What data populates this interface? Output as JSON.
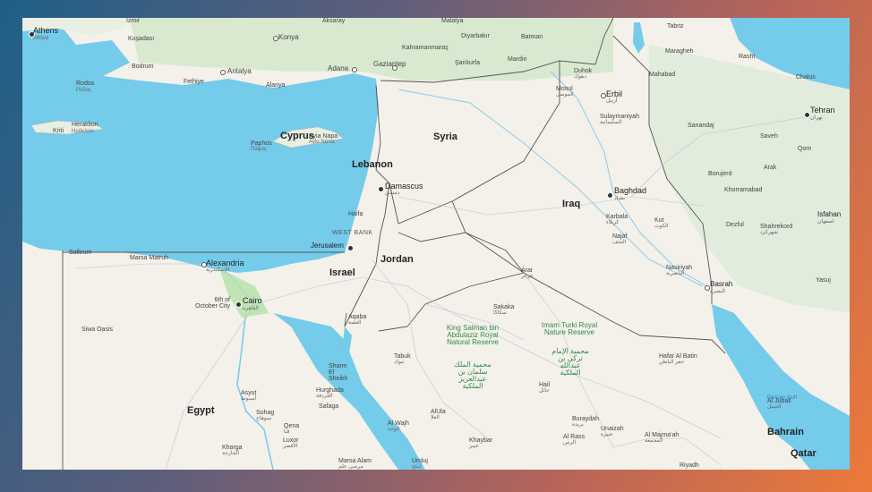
{
  "countries": [
    {
      "id": "syria",
      "label": "Syria"
    },
    {
      "id": "iraq",
      "label": "Iraq"
    },
    {
      "id": "lebanon",
      "label": "Lebanon"
    },
    {
      "id": "cyprus",
      "label": "Cyprus"
    },
    {
      "id": "israel",
      "label": "Israel"
    },
    {
      "id": "jordan",
      "label": "Jordan"
    },
    {
      "id": "egypt",
      "label": "Egypt"
    },
    {
      "id": "bahrain",
      "label": "Bahrain"
    },
    {
      "id": "qatar",
      "label": "Qatar"
    }
  ],
  "regions": {
    "west_bank": "WEST BANK"
  },
  "parks": {
    "king_salman": "King Salman bin Abdulaziz Royal Natural Reserve",
    "king_salman_ar": "محمية الملك سلمان بن عبدالعزيز الملكية",
    "imam_turki": "Imam Turki Royal Nature Reserve",
    "imam_turki_ar": "محمية الإمام تركي بن عبدالله الملكية"
  },
  "water": {
    "persian_gulf": "Persian Gulf"
  },
  "capitals": {
    "athens": "Athens",
    "athens_alt": "Αθήνα",
    "damascus": "Damascus",
    "damascus_ar": "دمشق",
    "baghdad": "Baghdad",
    "baghdad_ar": "بغداد",
    "tehran": "Tehran",
    "tehran_ar": "تهران",
    "cairo": "Cairo",
    "cairo_ar": "القاهرة",
    "jerusalem": "Jerusalem",
    "nicosia_ayia_napa": "Ayia Napa",
    "nicosia_alt": "Αγία Νάπα"
  },
  "cities": {
    "izmir": "İzmir",
    "aksaray": "Aksaray",
    "malatya": "Malatya",
    "tabriz": "Tabriz",
    "kusadasi": "Kuşadası",
    "konya": "Konya",
    "kahramanmaras": "Kahramanmaraş",
    "diyarbakir": "Diyarbakır",
    "batman": "Batman",
    "maragheh": "Maragheh",
    "bodrum": "Bodrum",
    "antalya": "Antalya",
    "adana": "Adana",
    "gaziantep": "Gaziantep",
    "sanliurfa": "Şanlıurfa",
    "mardin": "Mardin",
    "mahabad": "Mahabad",
    "rasht": "Rasht",
    "chalus": "Chalus",
    "rodos": "Rodos",
    "rodos_alt": "Ρόδος",
    "fethiye": "Fethiye",
    "alanya": "Alanya",
    "duhok": "Duhok",
    "duhok_ar": "دهوك",
    "erbil": "Erbil",
    "erbil_ar": "أربيل",
    "mosul": "Mosul",
    "mosul_ar": "الموصل",
    "kirti": "Kriti",
    "heraklion": "Heraklion",
    "heraklion_alt": "Ηράκλειο",
    "sulaymaniyah": "Sulaymaniyah",
    "sulaymaniyah_ar": "السليمانية",
    "paphos": "Paphos",
    "paphos_alt": "Πάφος",
    "sanandaj": "Sanandaj",
    "saveh": "Saveh",
    "qom": "Qom",
    "arak": "Arak",
    "borujerd": "Borujerd",
    "khorramabad": "Khorramabad",
    "isfahan": "Isfahan",
    "isfahan_ar": "اصفهان",
    "haifa": "Haifa",
    "karbala": "Karbala",
    "karbala_ar": "كربلاء",
    "najaf": "Najaf",
    "najaf_ar": "النجف",
    "kut": "Kut",
    "kut_ar": "الكوت",
    "dezful": "Dezful",
    "shahrekord": "Shahrekord",
    "shahrekord_ar": "شهرکرد",
    "saloum": "Salloum",
    "marsa_matruh": "Marsa Matruh",
    "alexandria": "Alexandria",
    "alexandria_ar": "الإسكندرية",
    "nasiriyah": "Nasiriyah",
    "nasiriyah_ar": "الناصرية",
    "basrah": "Basrah",
    "basrah_ar": "البصرة",
    "yasuj": "Yasuj",
    "arar": "Arar",
    "arar_ar": "عرعر",
    "sakaka": "Sakaka",
    "sakaka_ar": "سكاكا",
    "sixth_october": "6th of October City",
    "aqaba": "Aqaba",
    "aqaba_ar": "العقبة",
    "siwa": "Siwa Oasis",
    "tabuk": "Tabuk",
    "tabuk_ar": "تبوك",
    "hafar": "Hafar Al Batin",
    "hafar_ar": "حفر الباطن",
    "sharm": "Sharm El Sheikh",
    "hurghada": "Hurghada",
    "hurghada_ar": "الغردقة",
    "hail": "Hail",
    "hail_ar": "حائل",
    "asyut": "Asyut",
    "asyut_ar": "أسيوط",
    "sohag": "Sohag",
    "sohag_ar": "سوهاج",
    "safaga": "Safaga",
    "al_jubail": "Al Jubail",
    "al_jubail_ar": "الجبيل",
    "qena": "Qena",
    "qena_ar": "قنا",
    "al_wajh": "Al Wajh",
    "al_wajh_ar": "الوجه",
    "al_ula": "AlUla",
    "al_ula_ar": "العلا",
    "buraydah": "Buraydah",
    "buraydah_ar": "بريدة",
    "unaizah": "Unaizah",
    "unaizah_ar": "عنيزة",
    "kharga": "Kharga",
    "kharga_ar": "الخارجة",
    "luxor": "Luxor",
    "luxor_ar": "الأقصر",
    "khaybar": "Khaybar",
    "khaybar_ar": "خيبر",
    "al_rass": "Al Rass",
    "al_rass_ar": "الرس",
    "al_majmaah": "Al Majma'ah",
    "al_majmaah_ar": "المجمعة",
    "marsa_alam": "Marsa Alam",
    "marsa_alam_ar": "مرسى علم",
    "umluj": "Umluj",
    "umluj_ar": "أملج",
    "riyadh": "Riyadh"
  }
}
